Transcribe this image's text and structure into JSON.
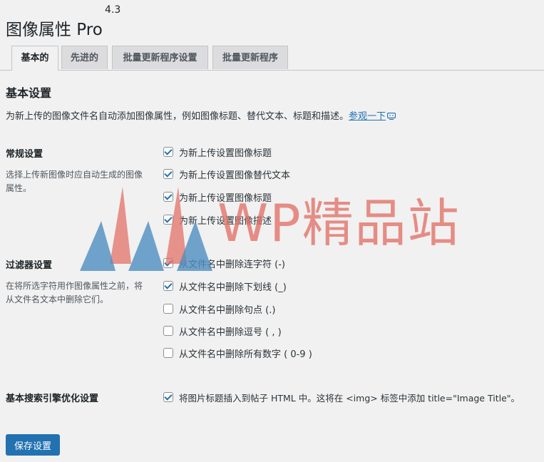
{
  "header": {
    "title": "图像属性 Pro",
    "version": "4.3"
  },
  "tabs": [
    {
      "label": "基本的",
      "active": true
    },
    {
      "label": "先进的",
      "active": false
    },
    {
      "label": "批量更新程序设置",
      "active": false
    },
    {
      "label": "批量更新程序",
      "active": false
    }
  ],
  "section": {
    "title": "基本设置",
    "intro": "为新上传的图像文件名自动添加图像属性，例如图像标题、替代文本、标题和描述。",
    "intro_link": "参观一下"
  },
  "general": {
    "label": "常规设置",
    "desc": "选择上传新图像时应自动生成的图像属性。",
    "options": [
      {
        "label": "为新上传设置图像标题",
        "checked": true
      },
      {
        "label": "为新上传设置图像替代文本",
        "checked": true
      },
      {
        "label": "为新上传设置图像标题",
        "checked": true
      },
      {
        "label": "为新上传设置图像描述",
        "checked": true
      }
    ]
  },
  "filter": {
    "label": "过滤器设置",
    "desc": "在将所选字符用作图像属性之前，将从文件名文本中删除它们。",
    "options": [
      {
        "label": "从文件名中删除连字符 (-)",
        "checked": true
      },
      {
        "label": "从文件名中删除下划线 (_)",
        "checked": true
      },
      {
        "label": "从文件名中删除句点 (.)",
        "checked": false
      },
      {
        "label": "从文件名中删除逗号 ( , )",
        "checked": false
      },
      {
        "label": "从文件名中删除所有数字 ( 0-9 )",
        "checked": false
      }
    ]
  },
  "seo": {
    "label": "基本搜索引擎优化设置",
    "options": [
      {
        "label": "将图片标题插入到帖子 HTML 中。这将在 <img> 标签中添加 title=\"Image Title\"。",
        "checked": true
      }
    ]
  },
  "save_label": "保存设置",
  "watermark": {
    "text": "WP精品站"
  },
  "colors": {
    "accent": "#2271b1",
    "watermark_red": "#e27066",
    "watermark_blue": "#4f8fc0"
  }
}
